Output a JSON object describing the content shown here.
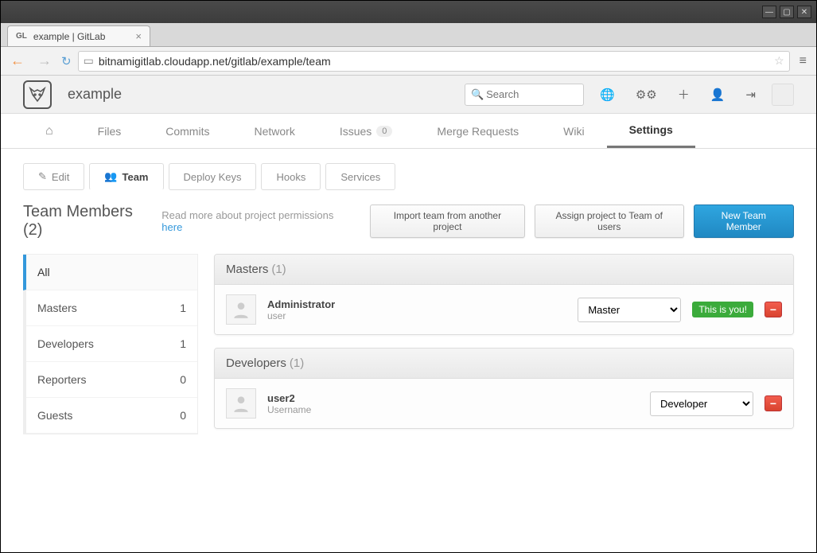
{
  "os": {
    "min": "—",
    "max": "▢",
    "close": "✕"
  },
  "browser": {
    "tab_favicon": "GL",
    "tab_title": "example | GitLab",
    "url": "bitnamigitlab.cloudapp.net/gitlab/example/team"
  },
  "header": {
    "project": "example",
    "search_placeholder": "Search"
  },
  "project_nav": {
    "home": "⌂",
    "files": "Files",
    "commits": "Commits",
    "network": "Network",
    "issues": "Issues",
    "issues_count": "0",
    "merge": "Merge Requests",
    "wiki": "Wiki",
    "settings": "Settings"
  },
  "subnav": {
    "edit": "Edit",
    "team": "Team",
    "deploy": "Deploy Keys",
    "hooks": "Hooks",
    "services": "Services"
  },
  "title": {
    "heading": "Team Members (2)",
    "subtext": "Read more about project permissions ",
    "link": "here"
  },
  "actions": {
    "import": "Import team from another project",
    "assign": "Assign project to Team of users",
    "new_member": "New Team Member"
  },
  "sidebar": {
    "items": [
      {
        "label": "All",
        "count": ""
      },
      {
        "label": "Masters",
        "count": "1"
      },
      {
        "label": "Developers",
        "count": "1"
      },
      {
        "label": "Reporters",
        "count": "0"
      },
      {
        "label": "Guests",
        "count": "0"
      }
    ]
  },
  "groups": [
    {
      "title": "Masters",
      "count": "(1)",
      "members": [
        {
          "name": "Administrator",
          "username": "user",
          "role": "Master",
          "you": "This is you!"
        }
      ]
    },
    {
      "title": "Developers",
      "count": "(1)",
      "members": [
        {
          "name": "user2",
          "username": "Username",
          "role": "Developer",
          "you": ""
        }
      ]
    }
  ]
}
